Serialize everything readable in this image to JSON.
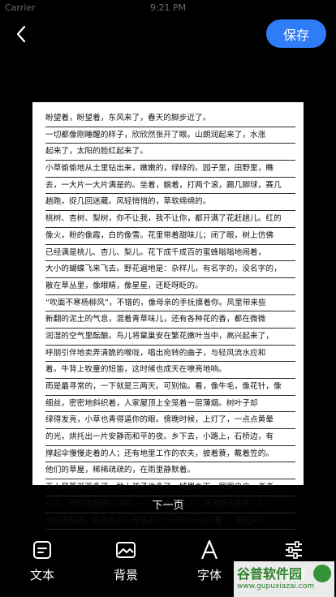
{
  "status": {
    "carrier": "Carrier",
    "time": "9:21 PM"
  },
  "nav": {
    "save_label": "保存"
  },
  "page": {
    "lines": [
      "盼望着，盼望着，东风来了，春天的脚步近了。",
      "一切都像刚睡醒的样子，欣欣然张开了眼。山朗润起来了，水涨",
      "起来了，太阳的脸红起来了。",
      "小草偷偷地从土里钻出来，嫩嫩的，绿绿的。园子里，田野里，瞧",
      "去，一大片一大片满是的。坐着，躺着，打两个滚，踢几脚球，赛几",
      "趟跑，捉几回迷藏。风轻悄悄的，草软绵绵的。",
      "桃树、杏树、梨树，你不让我，我不让你，都开满了花赶趟儿。红的",
      "像火，粉的像霞，白的像雪。花里带着甜味儿；闭了眼，树上仿佛",
      "已经满是桃儿、杏儿、梨儿。花下成千成百的蜜蜂嗡嗡地闹着，",
      "大小的蝴蝶飞来飞去。野花遍地是：杂样儿，有名字的，没名字的，",
      "散在草丛里，像眼睛，像星星，还眨呀眨的。",
      "“吹面不寒杨柳风”，不错的，像母亲的手抚摸着你。风里带来些",
      "新翻的泥土的气息，混着青草味儿，还有各种花的香，都在微微",
      "润湿的空气里酝酿。鸟儿将窠巢安在繁花嫩叶当中，高兴起来了，",
      "呼朋引伴地卖弄清脆的喉咙，唱出宛转的曲子，与轻风流水应和",
      "着。牛背上牧童的短笛，这时候也成天在嘹亮地响。",
      "雨是最寻常的，一下就是三两天。可别恼。看，像牛毛，像花针，像",
      "细丝，密密地斜织着，人家屋顶上全笼着一层薄烟。树叶子却",
      "绿得发亮，小草也青得逼你的眼。傍晚时候，上灯了，一点点黄晕",
      "的光，烘托出一片安静而和平的夜。乡下去，小路上，石桥边，有",
      "撑起伞慢慢走着的人；还有地里工作的农夫，披着蓑，戴着笠的。",
      "他们的草屋，稀稀疏疏的，在雨里静默着。",
      "天上风筝渐渐多了，地上孩子也多了。城里乡下，家家户户，老老",
      "小小，他们也赶趟儿似的，一个个都出来了。舒活舒活筋骨，抖",
      "擞抖擞精神，各做各的一份事去。“一年之计在于春”，刚起头儿，"
    ]
  },
  "next_page_label": "下一页",
  "toolbar": {
    "items": [
      {
        "label": "文本",
        "icon": "text-icon"
      },
      {
        "label": "背景",
        "icon": "image-icon"
      },
      {
        "label": "字体",
        "icon": "font-icon"
      },
      {
        "label": "设置",
        "icon": "sliders-icon"
      }
    ]
  },
  "watermark": {
    "title": "谷普软件园",
    "subtitle": "www.gupuxiazai.com"
  },
  "colors": {
    "accent": "#2f7df6",
    "background": "#000000",
    "page": "#ffffff"
  }
}
